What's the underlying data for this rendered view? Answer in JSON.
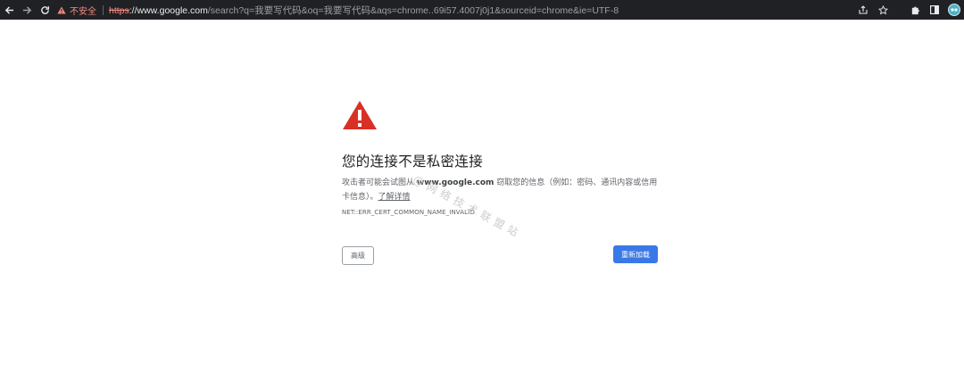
{
  "browser": {
    "security_label": "不安全",
    "url": {
      "scheme": "https",
      "host": "://www.google.com",
      "path": "/search?q=我要写代码&oq=我要写代码&aqs=chrome..69i57.4007j0j1&sourceid=chrome&ie=UTF-8"
    },
    "icons": {
      "back": "arrow-left",
      "forward": "arrow-right",
      "reload": "reload",
      "warning": "warning-triangle",
      "share": "share",
      "bookmark": "star",
      "extensions": "puzzle",
      "side_panel": "side-panel",
      "profile": "avatar"
    },
    "colors": {
      "toolbar_bg": "#202124",
      "not_secure": "#f28b82"
    }
  },
  "interstitial": {
    "heading": "您的连接不是私密连接",
    "message_part1": "攻击者可能会试图从 ",
    "message_host": "www.google.com",
    "message_part2": " 窃取您的信息（例如：密码、通讯内容或信用卡信息）。",
    "learn_more": "了解详情",
    "error_code": "NET::ERR_CERT_COMMON_NAME_INVALID",
    "advanced_button": "高级",
    "reload_button": "重新加载",
    "colors": {
      "danger_icon": "#d93025",
      "primary_button": "#3b78e7"
    }
  },
  "watermark": {
    "text": "@网络技术联盟站"
  }
}
